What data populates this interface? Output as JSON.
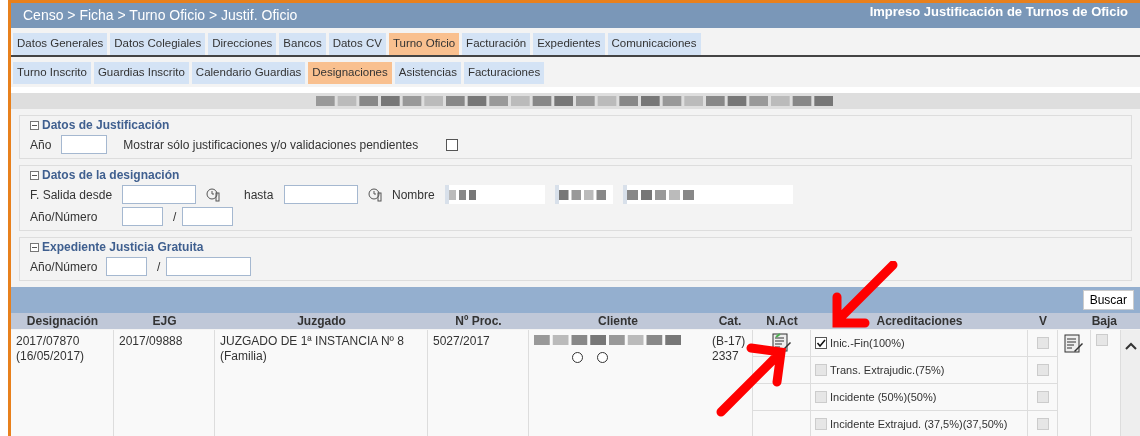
{
  "title_bar": {
    "breadcrumb": "Censo > Ficha > Turno Oficio > Justif. Oficio",
    "title": "Impreso Justificación de Turnos de Oficio"
  },
  "tabs": [
    {
      "label": "Datos Generales",
      "selected": false
    },
    {
      "label": "Datos Colegiales",
      "selected": false
    },
    {
      "label": "Direcciones",
      "selected": false
    },
    {
      "label": "Bancos",
      "selected": false
    },
    {
      "label": "Datos CV",
      "selected": false
    },
    {
      "label": "Turno Oficio",
      "selected": true
    },
    {
      "label": "Facturación",
      "selected": false
    },
    {
      "label": "Expedientes",
      "selected": false
    },
    {
      "label": "Comunicaciones",
      "selected": false
    }
  ],
  "subtabs": [
    {
      "label": "Turno Inscrito",
      "selected": false
    },
    {
      "label": "Guardias Inscrito",
      "selected": false
    },
    {
      "label": "Calendario Guardias",
      "selected": false
    },
    {
      "label": "Designaciones",
      "selected": true
    },
    {
      "label": "Asistencias",
      "selected": false
    },
    {
      "label": "Facturaciones",
      "selected": false
    }
  ],
  "justificacion": {
    "legend": "Datos de Justificación",
    "year_label": "Año",
    "pending_label": "Mostrar sólo justificaciones y/o validaciones pendientes",
    "pending_checked": false
  },
  "designacion": {
    "legend": "Datos de la designación",
    "from_label": "F. Salida desde",
    "to_label": "hasta",
    "name_label": "Nombre",
    "number_label": "Año/Número",
    "separator": "/"
  },
  "expediente": {
    "legend": "Expediente Justicia Gratuita",
    "number_label": "Año/Número",
    "separator": "/"
  },
  "search_button": "Buscar",
  "table": {
    "columns": [
      "Designación",
      "EJG",
      "Juzgado",
      "Nº Proc.",
      "Cliente",
      "Cat.",
      "N.Act",
      "Acreditaciones",
      "V",
      "Baja"
    ],
    "rows": [
      {
        "designacion": "2017/07870 (16/05/2017)",
        "ejg": "2017/09888",
        "juzgado": "JUZGADO DE 1ª INSTANCIA Nº 8 (Familia)",
        "proc": "5027/2017",
        "cat": "(B-17) 2337",
        "radios": [
          {
            "selected": false
          },
          {
            "selected": false
          }
        ],
        "baja_checked": false,
        "acreditaciones": [
          {
            "label": "Inic.-Fin(100%)",
            "checked": true,
            "validated": false
          },
          {
            "label": "Trans. Extrajudic.(75%)",
            "checked": false,
            "validated": false
          },
          {
            "label": "Incidente (50%)(50%)",
            "checked": false,
            "validated": false
          },
          {
            "label": "Incidente Extrajud. (37,5%)(37,50%)",
            "checked": false,
            "validated": false
          }
        ]
      }
    ]
  }
}
